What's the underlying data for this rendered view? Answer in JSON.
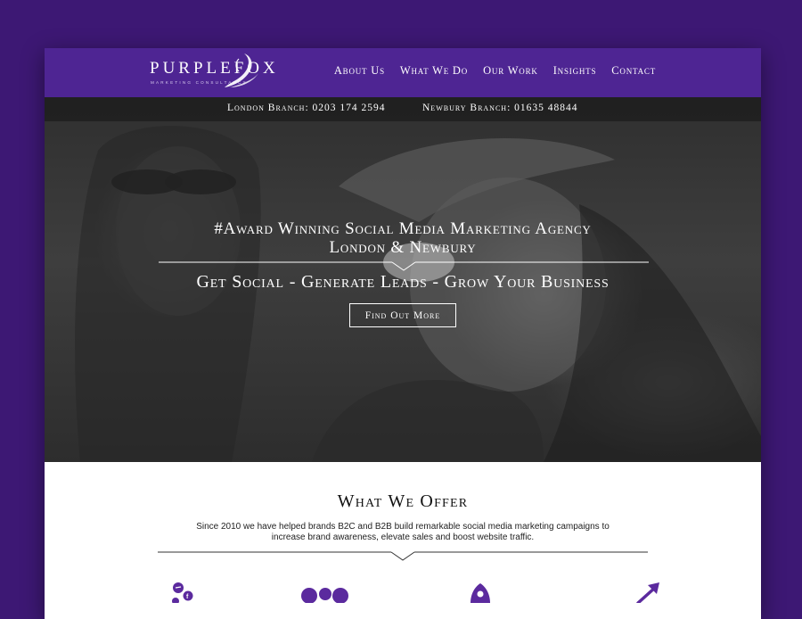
{
  "brand": {
    "name": "PURPLEFOX",
    "subtitle": "MARKETING CONSULTANCY"
  },
  "nav": {
    "items": [
      {
        "label": "About Us"
      },
      {
        "label": "What We Do"
      },
      {
        "label": "Our Work"
      },
      {
        "label": "Insights"
      },
      {
        "label": "Contact"
      }
    ]
  },
  "branches": {
    "london": "London Branch: 0203 174 2594",
    "newbury": "Newbury Branch: 01635 48844"
  },
  "hero": {
    "title_line1": "#Award Winning Social Media Marketing Agency",
    "title_line2": "London & Newbury",
    "tagline": "Get Social - Generate Leads - Grow Your Business",
    "cta": "Find Out More"
  },
  "offer": {
    "title": "What We Offer",
    "text": "Since 2010 we have helped brands B2C and B2B build remarkable social media marketing campaigns to increase brand awareness, elevate sales and boost website traffic."
  },
  "features": {
    "icons": [
      "social-media-icon",
      "team-icon",
      "rocket-icon",
      "growth-arrow-icon"
    ]
  },
  "colors": {
    "background": "#3d1874",
    "header": "#4e2593",
    "accent": "#5b2a9e",
    "white": "#ffffff"
  }
}
